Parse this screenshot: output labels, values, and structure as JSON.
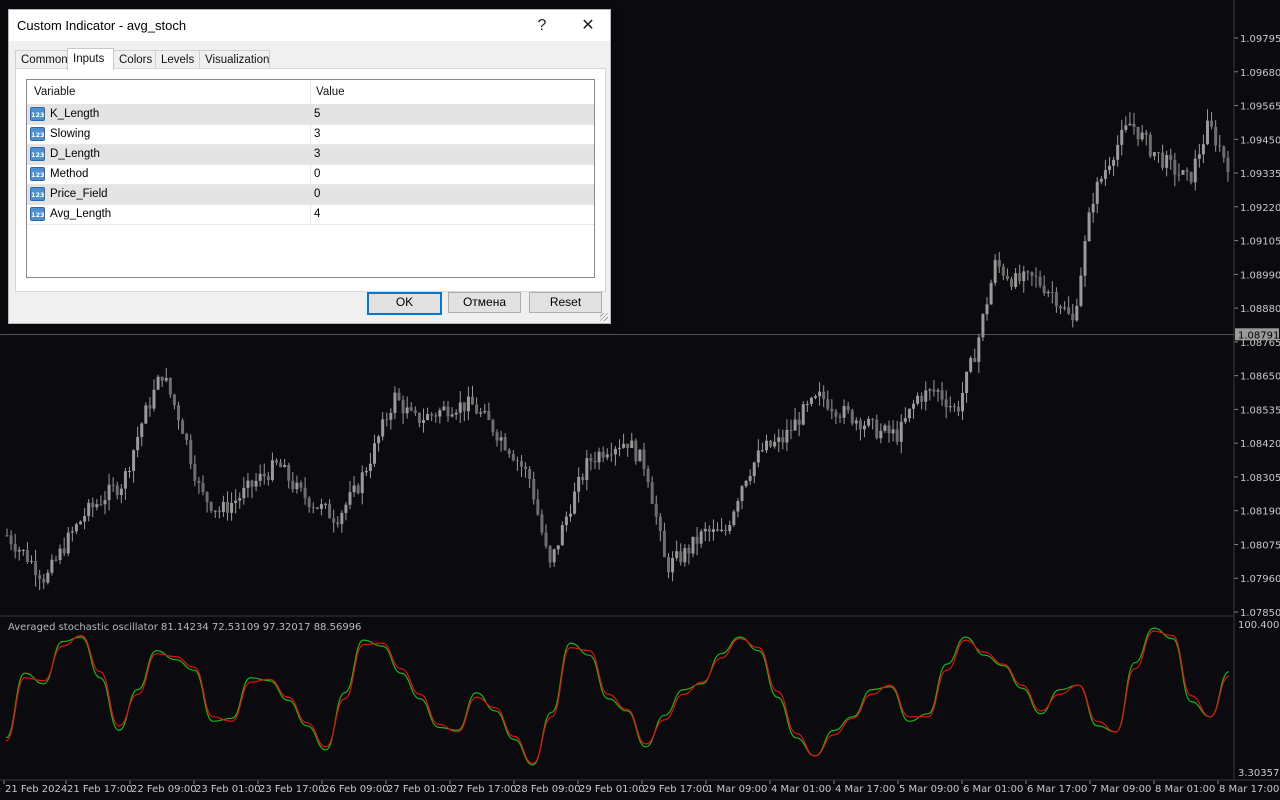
{
  "chart": {
    "price_ticks": [
      "1.09795",
      "1.09680",
      "1.09565",
      "1.09450",
      "1.09335",
      "1.09220",
      "1.09105",
      "1.08990",
      "1.08880",
      "1.08765",
      "1.08650",
      "1.08535",
      "1.08420",
      "1.08305",
      "1.08190",
      "1.08075",
      "1.07960",
      "1.07850"
    ],
    "current_price": "1.08791",
    "time_ticks": [
      "21 Feb 2024",
      "21 Feb 17:00",
      "22 Feb 09:00",
      "23 Feb 01:00",
      "23 Feb 17:00",
      "26 Feb 09:00",
      "27 Feb 01:00",
      "27 Feb 17:00",
      "28 Feb 09:00",
      "29 Feb 01:00",
      "29 Feb 17:00",
      "1 Mar 09:00",
      "4 Mar 01:00",
      "4 Mar 17:00",
      "5 Mar 09:00",
      "6 Mar 01:00",
      "6 Mar 17:00",
      "7 Mar 09:00",
      "8 Mar 01:00",
      "8 Mar 17:00"
    ],
    "osc_title": "Averaged stochastic oscillator 81.14234 72.53109 97.32017 88.56996",
    "osc_max": "100.40025",
    "osc_min": "3.30357",
    "colors": {
      "bg": "#0b0b0f",
      "candle": "#9a9a9a",
      "line_green": "#1db31d",
      "line_red": "#e01010",
      "grid_line": "#3a3a3a"
    }
  },
  "chart_data": {
    "type": "line",
    "title": "",
    "price_close_series": [
      1.0811,
      1.0804,
      1.0796,
      1.0808,
      1.0818,
      1.0824,
      1.0829,
      1.085,
      1.0866,
      1.0849,
      1.0825,
      1.0819,
      1.0824,
      1.083,
      1.0835,
      1.0826,
      1.0821,
      1.0817,
      1.0826,
      1.0841,
      1.0858,
      1.085,
      1.0852,
      1.0855,
      1.0855,
      1.0848,
      1.084,
      1.083,
      1.08,
      1.082,
      1.0836,
      1.0841,
      1.0843,
      1.0834,
      1.08,
      1.0805,
      1.0812,
      1.0811,
      1.083,
      1.084,
      1.0843,
      1.0852,
      1.0858,
      1.0853,
      1.085,
      1.0846,
      1.0845,
      1.0858,
      1.086,
      1.0853,
      1.0874,
      1.0903,
      1.0897,
      1.0898,
      1.0893,
      1.0883,
      1.0925,
      1.094,
      1.0951,
      1.0942,
      1.0936,
      1.0931,
      1.095,
      1.0937
    ],
    "osc_k": [
      26,
      69,
      62,
      90,
      93,
      66,
      31,
      58,
      84,
      78,
      71,
      37,
      39,
      66,
      64,
      51,
      34,
      18,
      56,
      91,
      87,
      69,
      52,
      33,
      31,
      56,
      44,
      25,
      8,
      43,
      89,
      81,
      52,
      44,
      20,
      41,
      58,
      62,
      82,
      93,
      84,
      53,
      26,
      14,
      31,
      40,
      58,
      60,
      37,
      42,
      75,
      93,
      81,
      74,
      59,
      42,
      58,
      61,
      34,
      30,
      76,
      99,
      92,
      50,
      40,
      70
    ],
    "osc_d": [
      24,
      66,
      64,
      87,
      94,
      70,
      34,
      55,
      82,
      80,
      73,
      40,
      37,
      63,
      65,
      53,
      36,
      20,
      52,
      88,
      89,
      72,
      55,
      35,
      30,
      53,
      46,
      27,
      9,
      40,
      86,
      84,
      55,
      45,
      22,
      38,
      55,
      63,
      79,
      92,
      86,
      57,
      29,
      14,
      28,
      39,
      55,
      61,
      40,
      40,
      71,
      91,
      83,
      75,
      61,
      44,
      55,
      61,
      37,
      30,
      72,
      97,
      94,
      54,
      40,
      67
    ]
  },
  "dialog": {
    "title": "Custom Indicator - avg_stoch",
    "help_label": "?",
    "close_label": "✕",
    "tabs": [
      "Common",
      "Inputs",
      "Colors",
      "Levels",
      "Visualization"
    ],
    "active_tab": "Inputs",
    "columns": [
      "Variable",
      "Value"
    ],
    "rows": [
      {
        "icon": "123",
        "name": "K_Length",
        "value": "5"
      },
      {
        "icon": "123",
        "name": "Slowing",
        "value": "3"
      },
      {
        "icon": "123",
        "name": "D_Length",
        "value": "3"
      },
      {
        "icon": "123",
        "name": "Method",
        "value": "0"
      },
      {
        "icon": "123",
        "name": "Price_Field",
        "value": "0"
      },
      {
        "icon": "123",
        "name": "Avg_Length",
        "value": "4"
      }
    ],
    "buttons": {
      "ok": "OK",
      "cancel": "Отмена",
      "reset": "Reset"
    }
  }
}
